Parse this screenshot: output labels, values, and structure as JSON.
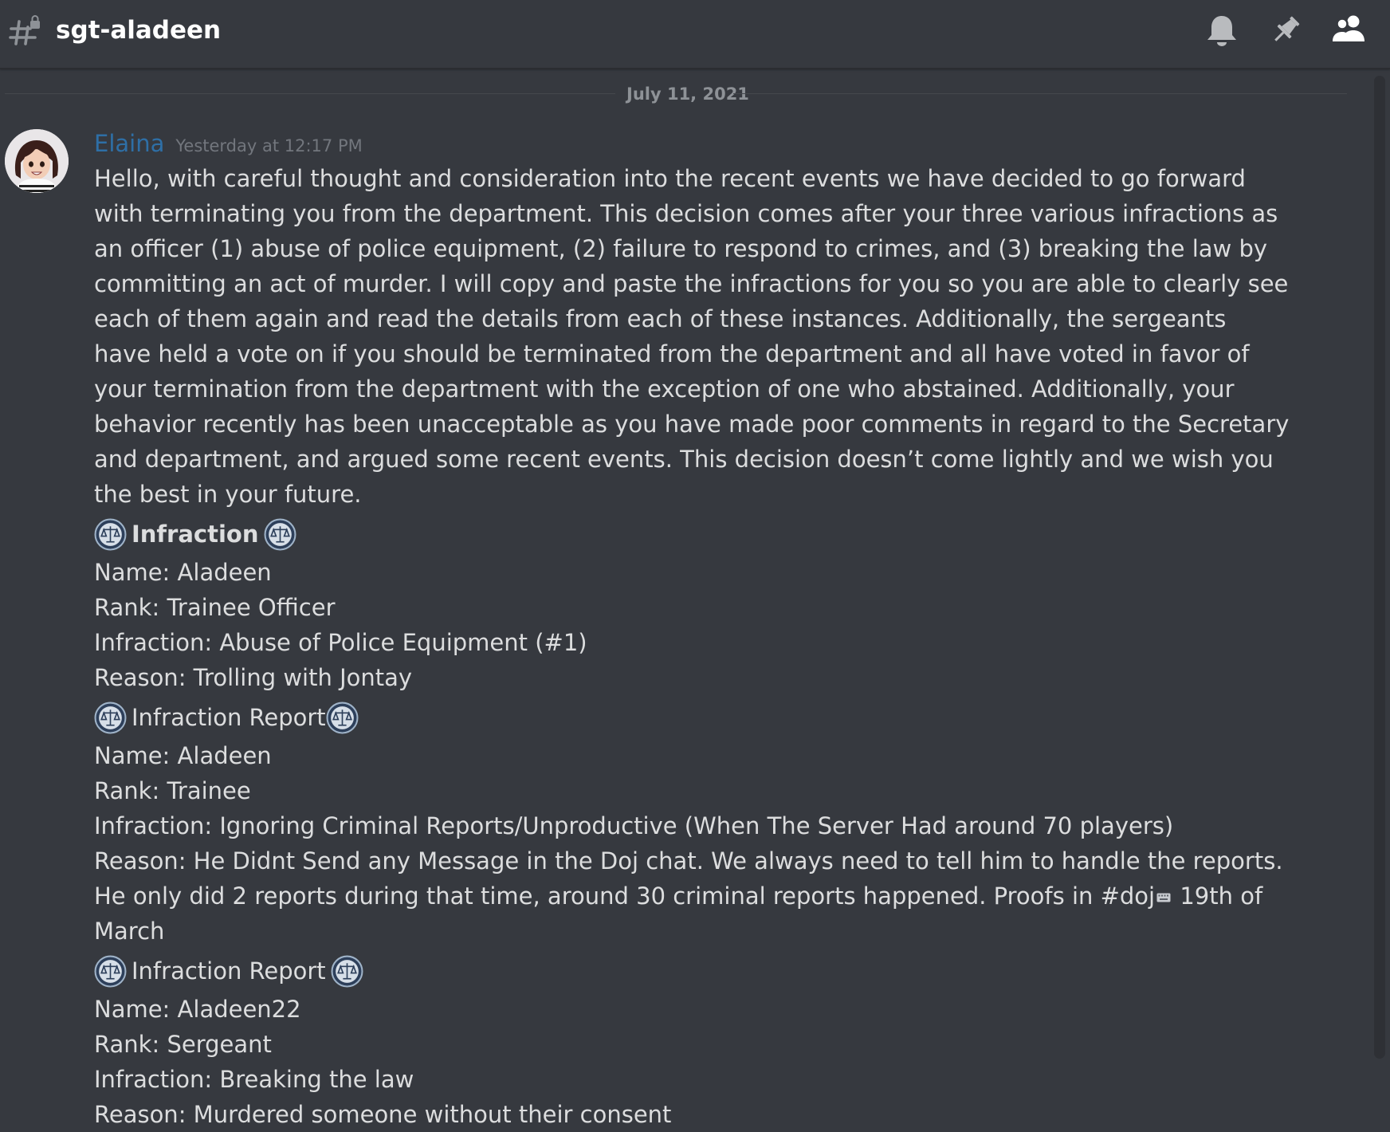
{
  "header": {
    "channel_name": "sgt-aladeen",
    "icons": [
      "locked-text-channel-icon",
      "bell-icon",
      "pin-icon",
      "members-icon"
    ]
  },
  "date_divider": "July 11, 2021",
  "message": {
    "author": "Elaina",
    "author_color": "#2e6fa6",
    "timestamp": "Yesterday at 12:17 PM",
    "intro": "Hello, with careful thought and consideration into the recent events we have decided to go forward with terminating you from the department. This decision comes after your three various infractions as an officer (1) abuse of police equipment, (2) failure to respond to crimes, and (3) breaking the law by committing an act of murder. I will copy and paste the infractions for you so you are able to clearly see each of them again and read the details from each of these instances. Additionally, the sergeants have held a vote on if you should be terminated from the department and all have voted in favor of your termination from the department with the exception of one who abstained. Additionally, your behavior recently has been unacceptable as you have made poor comments in regard to the Secretary and department, and argued some recent events. This decision doesn’t come lightly and we wish you the best in your future.",
    "reports": [
      {
        "title": "Infraction",
        "name": "Name: Aladeen",
        "rank": "Rank: Trainee Officer",
        "infraction": "Infraction: Abuse of Police Equipment (#1)",
        "reason": "Reason: Trolling with Jontay"
      },
      {
        "title": "Infraction Report",
        "name": "Name: Aladeen",
        "rank": "Rank: Trainee",
        "infraction": "Infraction: Ignoring Criminal Reports/Unproductive (When The Server Had around 70 players)",
        "reason": "Reason: He Didnt Send any Message in the Doj chat. We always need to tell him to handle the reports. He only did 2 reports during that time, around 30 criminal reports happened. Proofs in #doj",
        "reason_suffix": " 19th of March"
      },
      {
        "title": "Infraction Report",
        "name": "Name: Aladeen22",
        "rank": "Rank: Sergeant",
        "infraction": "Infraction: Breaking the law",
        "reason": "Reason: Murdered someone without their consent"
      }
    ]
  }
}
